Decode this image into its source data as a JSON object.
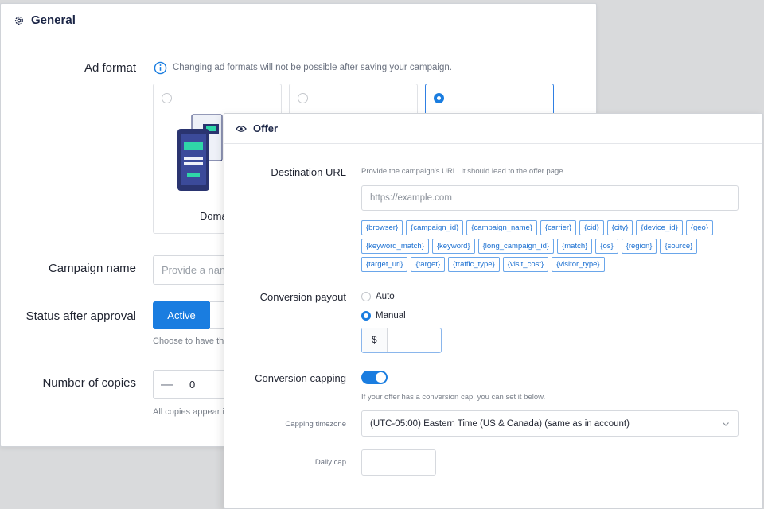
{
  "general": {
    "title": "General",
    "ad_format": {
      "label": "Ad format",
      "note": "Changing ad formats will not be possible after saving your campaign.",
      "cards": [
        {
          "label": "Doma",
          "selected": false
        },
        {
          "label": "",
          "selected": false
        },
        {
          "label": "",
          "selected": true
        }
      ]
    },
    "campaign_name": {
      "label": "Campaign name",
      "placeholder": "Provide a nam"
    },
    "status": {
      "label": "Status after approval",
      "active_label": "Active",
      "help": "Choose to have the"
    },
    "copies": {
      "label": "Number of copies",
      "minus": "—",
      "value": "0",
      "help": "All copies appear i"
    }
  },
  "offer": {
    "title": "Offer",
    "destination": {
      "label": "Destination URL",
      "help": "Provide the campaign's URL. It should lead to the offer page.",
      "placeholder": "https://example.com",
      "tokens": [
        "{browser}",
        "{campaign_id}",
        "{campaign_name}",
        "{carrier}",
        "{cid}",
        "{city}",
        "{device_id}",
        "{geo}",
        "{keyword_match}",
        "{keyword}",
        "{long_campaign_id}",
        "{match}",
        "{os}",
        "{region}",
        "{source}",
        "{target_url}",
        "{target}",
        "{traffic_type}",
        "{visit_cost}",
        "{visitor_type}"
      ]
    },
    "payout": {
      "label": "Conversion payout",
      "auto_label": "Auto",
      "manual_label": "Manual",
      "selected": "Manual",
      "currency": "$",
      "value": ""
    },
    "capping": {
      "label": "Conversion capping",
      "enabled": true,
      "help": "If your offer has a conversion cap, you can set it below.",
      "timezone_label": "Capping timezone",
      "timezone_value": "(UTC-05:00) Eastern Time (US & Canada) (same as in account)",
      "daily_label": "Daily cap",
      "daily_value": ""
    }
  },
  "colors": {
    "accent": "#1a7de0",
    "token_text": "#1a6fd1",
    "title": "#1b2546"
  }
}
